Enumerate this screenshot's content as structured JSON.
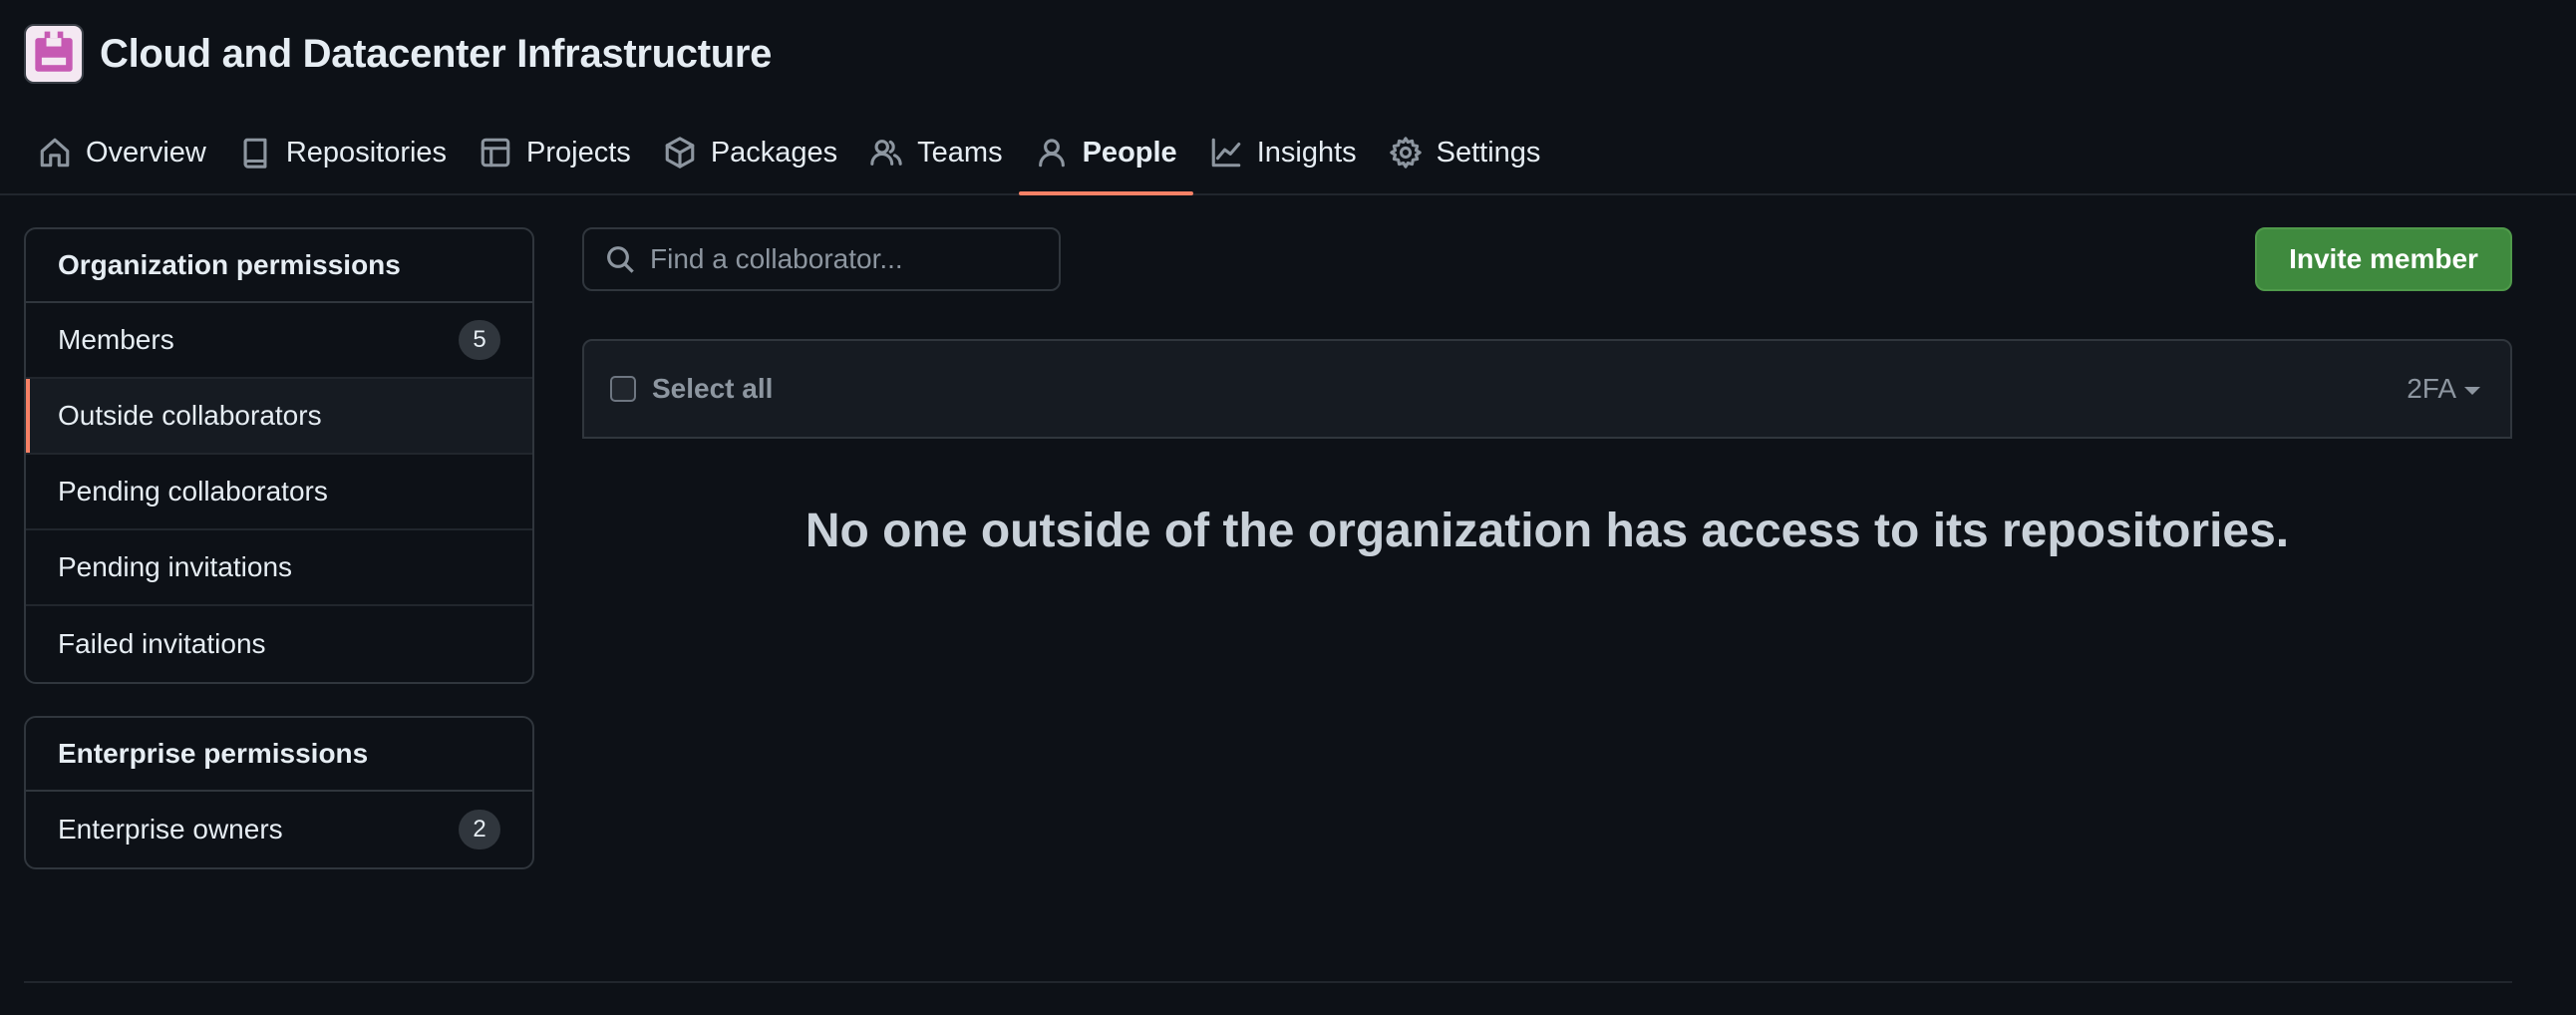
{
  "org": {
    "title": "Cloud and Datacenter Infrastructure",
    "avatar_color": "#c659b3"
  },
  "nav": {
    "items": [
      {
        "label": "Overview",
        "icon": "home-icon"
      },
      {
        "label": "Repositories",
        "icon": "repo-icon"
      },
      {
        "label": "Projects",
        "icon": "table-icon"
      },
      {
        "label": "Packages",
        "icon": "package-icon"
      },
      {
        "label": "Teams",
        "icon": "people-icon"
      },
      {
        "label": "People",
        "icon": "person-icon",
        "active": true
      },
      {
        "label": "Insights",
        "icon": "graph-icon"
      },
      {
        "label": "Settings",
        "icon": "gear-icon"
      }
    ]
  },
  "sidebar": {
    "org_permissions": {
      "heading": "Organization permissions",
      "items": [
        {
          "label": "Members",
          "count": "5"
        },
        {
          "label": "Outside collaborators",
          "selected": true
        },
        {
          "label": "Pending collaborators"
        },
        {
          "label": "Pending invitations"
        },
        {
          "label": "Failed invitations"
        }
      ]
    },
    "enterprise_permissions": {
      "heading": "Enterprise permissions",
      "items": [
        {
          "label": "Enterprise owners",
          "count": "2"
        }
      ]
    }
  },
  "search": {
    "placeholder": "Find a collaborator..."
  },
  "toolbar": {
    "invite_label": "Invite member"
  },
  "table": {
    "select_all_label": "Select all",
    "filter_label": "2FA"
  },
  "blankslate": {
    "message": "No one outside of the organization has access to its repositories."
  },
  "colors": {
    "background": "#0d1117",
    "accent_underline": "#f78166",
    "invite_button": "#3f8a3e"
  }
}
